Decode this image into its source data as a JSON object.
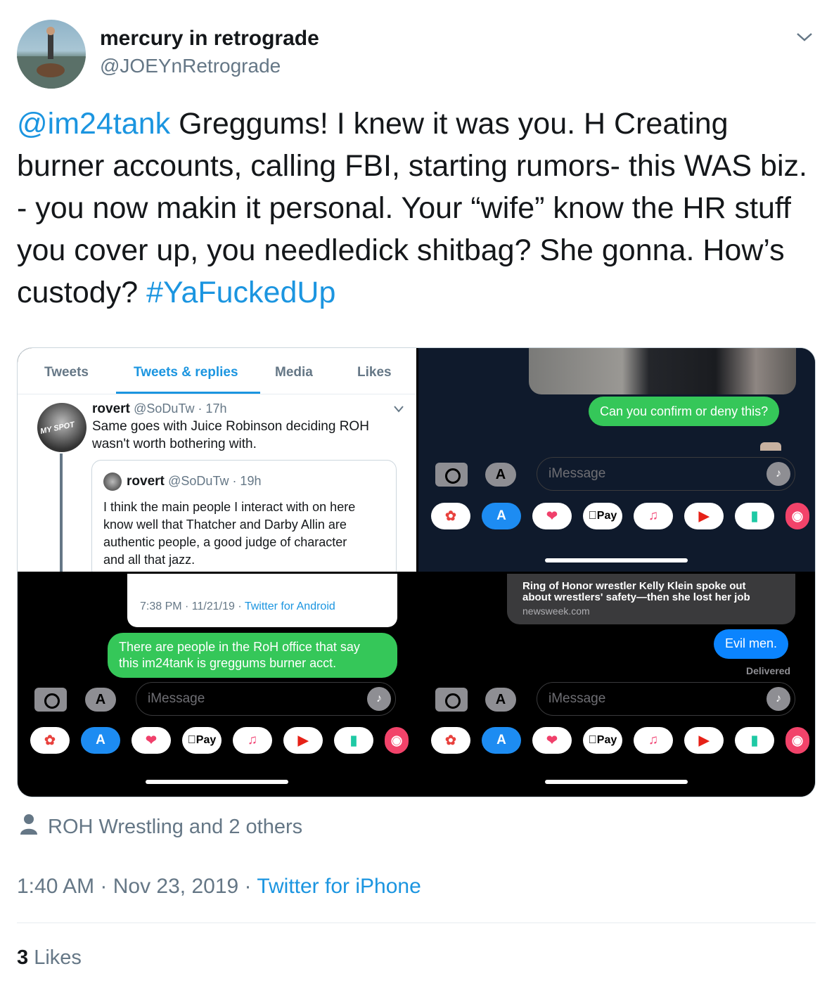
{
  "author": {
    "display_name": "mercury in retrograde",
    "handle": "@JOEYnRetrograde"
  },
  "tweet": {
    "mention": "@im24tank",
    "body": " Greggums! I knew it was you. H Creating burner accounts, calling FBI, starting rumors- this WAS biz. - you now makin it personal. Your “wife” know the HR stuff you cover up, you needledick shitbag? She gonna. How’s custody? ",
    "hashtag": "#YaFuckedUp"
  },
  "screenshot1": {
    "tabs": [
      "Tweets",
      "Tweets & replies",
      "Media",
      "Likes"
    ],
    "active_tab": "Tweets & replies",
    "reply_name": "rovert",
    "reply_meta": "@SoDuTw · 17h",
    "reply_text_1": "Same goes with Juice Robinson deciding ROH",
    "reply_text_2": "wasn't worth bothering with.",
    "quote_name": "rovert",
    "quote_meta": "@SoDuTw · 19h",
    "quote_lines": [
      "I think the main people I interact with on here",
      "know well that Thatcher and Darby Allin are",
      "authentic people, a good judge of character",
      "and all that jazz."
    ],
    "avatar_text": "MY SPOT"
  },
  "screenshot2": {
    "bubble": "Can you confirm or deny this?",
    "placeholder": "iMessage"
  },
  "screenshot3": {
    "meta_time": "7:38 PM · 11/21/19 · ",
    "meta_source": "Twitter for Android",
    "bubble_line1": "There are people in the RoH office that say",
    "bubble_line2": "this im24tank is greggums burner acct.",
    "placeholder": "iMessage"
  },
  "screenshot4": {
    "link_title_1": "Ring of Honor wrestler Kelly Klein spoke out",
    "link_title_2": "about wrestlers' safety—then she lost her job",
    "link_domain": "newsweek.com",
    "bubble": "Evil men.",
    "status": "Delivered",
    "placeholder": "iMessage"
  },
  "app_icons": [
    "photos-icon",
    "appstore-icon",
    "heart-sticker-icon",
    "applepay-icon",
    "music-icon",
    "youtube-icon",
    "giphy-icon",
    "globe-icon"
  ],
  "applepay_label": "Pay",
  "social_context": "ROH Wrestling and 2 others",
  "timestamp": "1:40 AM · Nov 23, 2019 · ",
  "source": "Twitter for iPhone",
  "likes": {
    "count": "3",
    "label": " Likes"
  },
  "colors": {
    "link": "#1b95e0",
    "imessage_green": "#35c759",
    "imessage_blue": "#0b84fe"
  }
}
